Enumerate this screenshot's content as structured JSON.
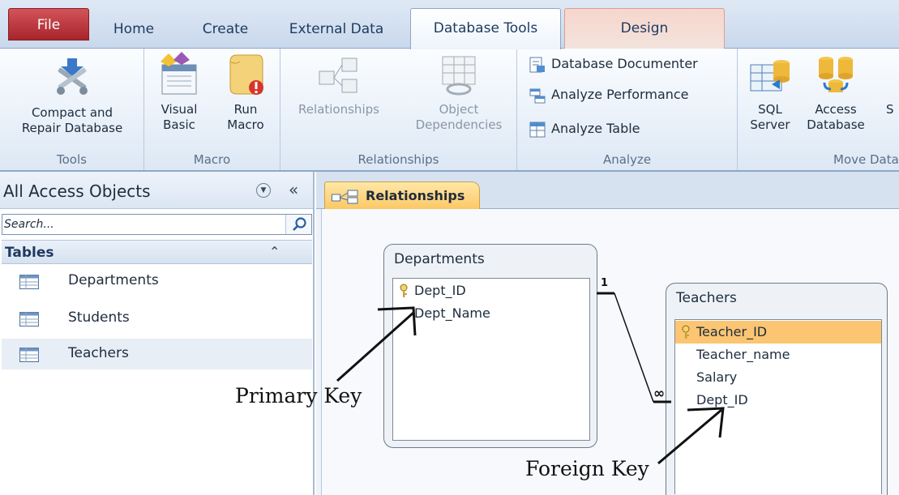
{
  "tabs": {
    "file": "File",
    "home": "Home",
    "create": "Create",
    "external_data": "External Data",
    "database_tools": "Database Tools",
    "design": "Design"
  },
  "ribbon": {
    "tools": {
      "label": "Tools",
      "compact_repair_line1": "Compact and",
      "compact_repair_line2": "Repair Database"
    },
    "macro": {
      "label": "Macro",
      "visual_basic_line1": "Visual",
      "visual_basic_line2": "Basic",
      "run_macro_line1": "Run",
      "run_macro_line2": "Macro"
    },
    "relationships": {
      "label": "Relationships",
      "relationships_button": "Relationships",
      "object_dependencies_line1": "Object",
      "object_dependencies_line2": "Dependencies"
    },
    "analyze": {
      "label": "Analyze",
      "database_documenter": "Database Documenter",
      "analyze_performance": "Analyze Performance",
      "analyze_table": "Analyze Table"
    },
    "move_data": {
      "label": "Move Data",
      "sql_server_line1": "SQL",
      "sql_server_line2": "Server",
      "access_database_line1": "Access",
      "access_database_line2": "Database",
      "partial_next": "S"
    }
  },
  "nav_pane": {
    "title": "All Access Objects",
    "search_placeholder": "Search...",
    "group": "Tables",
    "items": [
      {
        "label": "Departments"
      },
      {
        "label": "Students"
      },
      {
        "label": "Teachers"
      }
    ]
  },
  "document": {
    "tab_label": "Relationships",
    "tables": [
      {
        "title": "Departments",
        "fields": [
          "Dept_ID",
          "Dept_Name"
        ],
        "primary_key": "Dept_ID"
      },
      {
        "title": "Teachers",
        "fields": [
          "Teacher_ID",
          "Teacher_name",
          "Salary",
          "Dept_ID"
        ],
        "primary_key": "Teacher_ID"
      }
    ],
    "relationship": {
      "one_side": "1",
      "many_side": "∞"
    }
  },
  "annotations": {
    "primary_key": "Primary Key",
    "foreign_key": "Foreign Key"
  },
  "colors": {
    "file_tab": "#b8313a",
    "selected_field": "#fbc572",
    "document_tab": "#fcc866"
  }
}
